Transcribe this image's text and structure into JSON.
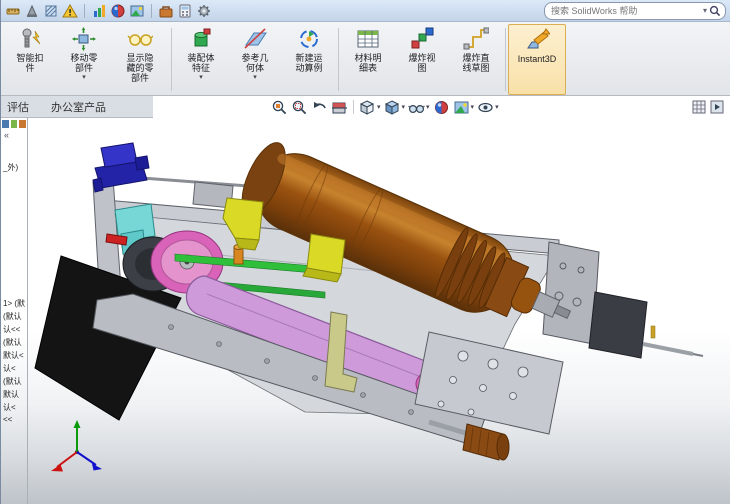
{
  "ui": {
    "caret": "▾",
    "collapse_glyph": "«"
  },
  "app": {
    "search": {
      "placeholder": "搜索 SolidWorks 帮助"
    }
  },
  "quick_toolbar": {
    "icons": [
      "measure",
      "mass-properties",
      "section-properties",
      "interference-detection",
      "assembly-visualization",
      "edit-appearance",
      "apply-scene",
      "toolbox",
      "design-calculator",
      "options"
    ]
  },
  "ribbon": {
    "buttons": [
      {
        "id": "smart-fasteners",
        "lines": [
          "智能扣",
          "件"
        ],
        "caret": false
      },
      {
        "id": "move-component",
        "lines": [
          "移动零",
          "部件"
        ],
        "caret": true
      },
      {
        "id": "show-hidden-components",
        "lines": [
          "显示隐",
          "藏的零",
          "部件"
        ],
        "caret": false
      },
      {
        "id": "assembly-features",
        "lines": [
          "装配体",
          "特征"
        ],
        "caret": true
      },
      {
        "id": "reference-geometry",
        "lines": [
          "参考几",
          "何体"
        ],
        "caret": true
      },
      {
        "id": "new-motion-study",
        "lines": [
          "新建运",
          "动算例"
        ],
        "caret": false
      },
      {
        "id": "bill-of-materials",
        "lines": [
          "材料明",
          "细表"
        ],
        "caret": false
      },
      {
        "id": "exploded-view",
        "lines": [
          "爆炸视",
          "图"
        ],
        "caret": false
      },
      {
        "id": "explode-line-sketch",
        "lines": [
          "爆炸直",
          "线草图"
        ],
        "caret": false
      },
      {
        "id": "instant3d",
        "lines": [
          "Instant3D"
        ],
        "caret": false
      }
    ]
  },
  "tabs": {
    "items": [
      {
        "label": "评估"
      },
      {
        "label": "办公室产品"
      }
    ]
  },
  "feature_tree": {
    "fragments": [
      "_外)",
      "1> (默",
      "(默认",
      "认<<",
      "(默认",
      "默认<",
      "认<",
      "(默认",
      "默认",
      "认<",
      "<<"
    ]
  },
  "hud": {
    "items": [
      "zoom-fit",
      "zoom-area",
      "previous-view",
      "section-view",
      "view-orientation",
      "display-style",
      "hide-show-items",
      "edit-appearance",
      "apply-scene",
      "view-settings"
    ]
  },
  "model": {
    "colors": {
      "frame": "#c9cdd3",
      "deck": "#d4d8dd",
      "barrel": "#8f4e10",
      "belt": "#cf9ada",
      "pulley": "#d863b8",
      "wheel": "#3c4046",
      "rail_green": "#2fbf3a",
      "bracket_blue": "#2323a8",
      "cyan": "#77d6d6",
      "yellow": "#d9d926",
      "olive": "#c9c98a",
      "black_plate": "#141414",
      "knob": "#8a4a14",
      "red": "#cc2222",
      "orange": "#d8871e",
      "triad_x": "#cc1111",
      "triad_y": "#0a9a0a",
      "triad_z": "#1111cc"
    }
  }
}
